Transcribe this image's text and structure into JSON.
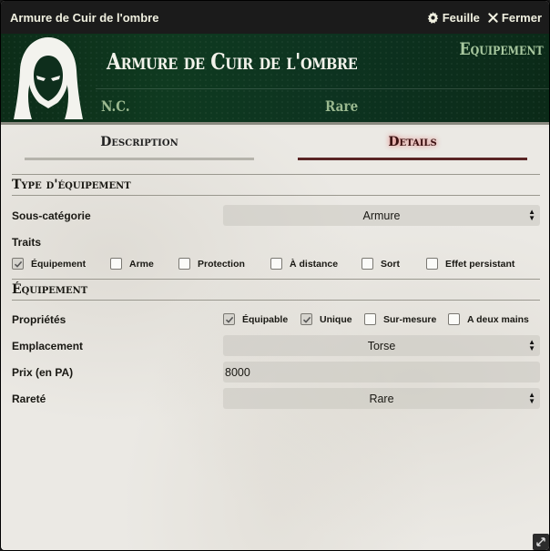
{
  "window": {
    "title": "Armure de Cuir de l'ombre",
    "sheet_label": "Feuille",
    "close_label": "Fermer"
  },
  "header": {
    "name": "Armure de Cuir de l'ombre",
    "type": "Equipement",
    "level": "N.C.",
    "rarity": "Rare"
  },
  "tabs": [
    {
      "label": "Description",
      "active": false
    },
    {
      "label": "Details",
      "active": true
    }
  ],
  "sections": {
    "type_title": "Type d'équipement",
    "equipment_title": "Équipement"
  },
  "fields": {
    "subcategory_label": "Sous-catégorie",
    "subcategory_value": "Armure",
    "traits_label": "Traits",
    "traits": [
      {
        "label": "Équipement",
        "checked": true
      },
      {
        "label": "Arme",
        "checked": false
      },
      {
        "label": "Protection",
        "checked": false
      },
      {
        "label": "À distance",
        "checked": false
      },
      {
        "label": "Sort",
        "checked": false
      },
      {
        "label": "Effet persistant",
        "checked": false
      }
    ],
    "properties_label": "Propriétés",
    "properties": [
      {
        "label": "Équipable",
        "checked": true
      },
      {
        "label": "Unique",
        "checked": true
      },
      {
        "label": "Sur-mesure",
        "checked": false
      },
      {
        "label": "A deux mains",
        "checked": false
      }
    ],
    "slot_label": "Emplacement",
    "slot_value": "Torse",
    "price_label": "Prix (en PA)",
    "price_value": "8000",
    "rarity_label": "Rareté",
    "rarity_value": "Rare"
  },
  "colors": {
    "header_bg": "#0f3a20",
    "header_accent": "#9ab88f",
    "active_tab": "#5a2525"
  },
  "icons": {
    "sheet": "gear-icon",
    "close": "close-icon",
    "avatar": "hooded-figure-icon",
    "resize": "resize-icon"
  }
}
